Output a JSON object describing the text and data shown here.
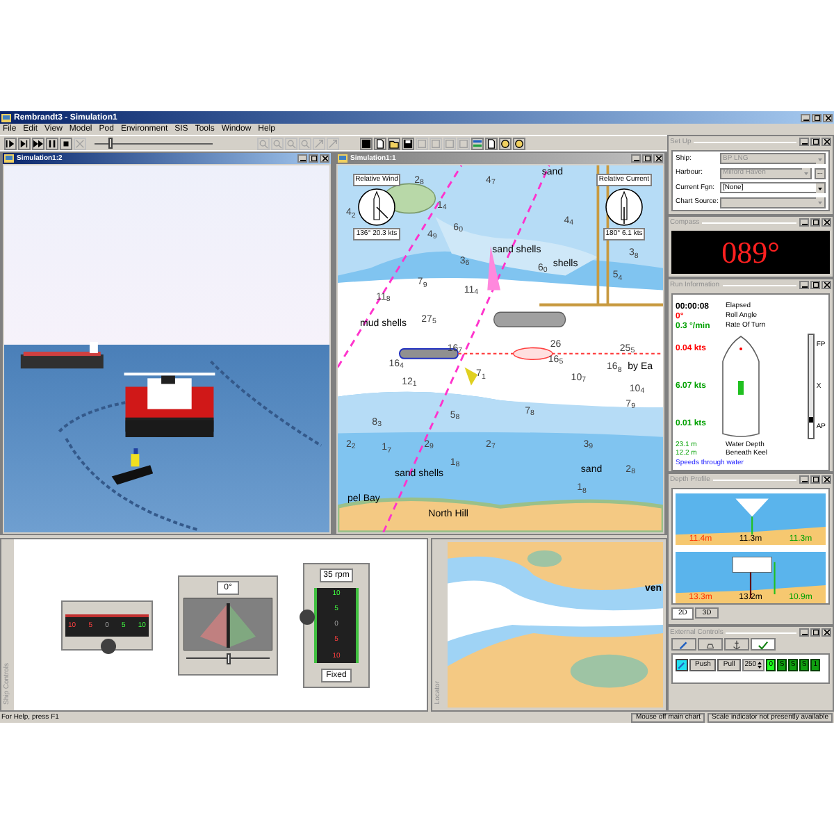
{
  "window": {
    "title": "Rembrandt3 - Simulation1"
  },
  "menu": [
    "File",
    "Edit",
    "View",
    "Model",
    "Pod",
    "Environment",
    "SIS",
    "Tools",
    "Window",
    "Help"
  ],
  "toolbar": {
    "groups": [
      [
        {
          "disabled": false
        },
        {
          "disabled": false
        },
        {
          "disabled": false
        },
        {
          "disabled": false
        },
        {
          "disabled": false
        },
        {
          "disabled": true
        }
      ],
      [
        {
          "disabled": true
        },
        {
          "disabled": true
        },
        {
          "disabled": true
        },
        {
          "disabled": true
        },
        {
          "disabled": true
        },
        {
          "disabled": true
        }
      ],
      [
        {
          "disabled": false
        },
        {
          "disabled": false
        },
        {
          "disabled": false
        },
        {
          "disabled": false
        },
        {
          "disabled": true
        },
        {
          "disabled": true
        },
        {
          "disabled": true
        },
        {
          "disabled": true
        },
        {
          "disabled": false
        },
        {
          "disabled": false
        },
        {
          "disabled": false
        },
        {
          "disabled": false
        }
      ]
    ],
    "slider": {
      "level": 0.12
    }
  },
  "views": [
    {
      "kind": "scene",
      "title": "Simulation1:2",
      "active": true
    },
    {
      "kind": "chart",
      "title": "Simulation1:1",
      "active": false,
      "gauges": [
        {
          "label": "Relative Wind",
          "reading": "136° 20.3 kts"
        },
        {
          "label": "Relative Current",
          "reading": "180° 6.1 kts"
        }
      ],
      "chart_labels": [
        {
          "kind": "name",
          "text": "sand"
        },
        {
          "kind": "sounding",
          "text": "2$_{8}$"
        },
        {
          "kind": "sounding",
          "text": "4$_{7}$"
        },
        {
          "kind": "sounding",
          "text": "4$_{2}$"
        },
        {
          "kind": "sounding",
          "text": "1$_{4}$"
        },
        {
          "kind": "sounding",
          "text": "4$_{4}$"
        },
        {
          "kind": "sounding",
          "text": "6$_{0}$"
        },
        {
          "kind": "sounding",
          "text": "4$_{9}$"
        },
        {
          "kind": "name",
          "text": "sand shells"
        },
        {
          "kind": "sounding",
          "text": "3$_{6}$"
        },
        {
          "kind": "sounding",
          "text": "3$_{8}$"
        },
        {
          "kind": "name",
          "text": "shells"
        },
        {
          "kind": "sounding",
          "text": "6$_{0}$"
        },
        {
          "kind": "sounding",
          "text": "5$_{4}$"
        },
        {
          "kind": "sounding",
          "text": "7$_{9}$"
        },
        {
          "kind": "sounding",
          "text": "11$_{4}$"
        },
        {
          "kind": "sounding",
          "text": "11$_{8}$"
        },
        {
          "kind": "name",
          "text": "mud shells"
        },
        {
          "kind": "sounding",
          "text": "27$_{5}$"
        },
        {
          "kind": "sounding",
          "text": "26"
        },
        {
          "kind": "sounding",
          "text": "25$_{5}$"
        },
        {
          "kind": "sounding",
          "text": "16$_{7}$"
        },
        {
          "kind": "sounding",
          "text": "16$_{4}$"
        },
        {
          "kind": "sounding",
          "text": "16$_{5}$"
        },
        {
          "kind": "sounding",
          "text": "16$_{8}$"
        },
        {
          "kind": "name",
          "text": "by Ea"
        },
        {
          "kind": "sounding",
          "text": "12$_{1}$"
        },
        {
          "kind": "sounding",
          "text": "7$_{1}$"
        },
        {
          "kind": "sounding",
          "text": "10$_{7}$"
        },
        {
          "kind": "sounding",
          "text": "10$_{4}$"
        },
        {
          "kind": "sounding",
          "text": "7$_{9}$"
        },
        {
          "kind": "sounding",
          "text": "5$_{8}$"
        },
        {
          "kind": "sounding",
          "text": "7$_{8}$"
        },
        {
          "kind": "sounding",
          "text": "8$_{3}$"
        },
        {
          "kind": "sounding",
          "text": "2$_{2}$"
        },
        {
          "kind": "sounding",
          "text": "1$_{7}$"
        },
        {
          "kind": "sounding",
          "text": "2$_{9}$"
        },
        {
          "kind": "sounding",
          "text": "2$_{7}$"
        },
        {
          "kind": "sounding",
          "text": "3$_{9}$"
        },
        {
          "kind": "sounding",
          "text": "1$_{8}$"
        },
        {
          "kind": "name",
          "text": "sand shells"
        },
        {
          "kind": "name",
          "text": "sand"
        },
        {
          "kind": "sounding",
          "text": "2$_{8}$"
        },
        {
          "kind": "sounding",
          "text": "1$_{8}$"
        },
        {
          "kind": "name",
          "text": "pel Bay"
        },
        {
          "kind": "name",
          "text": "North Hill"
        }
      ]
    }
  ],
  "ship_controls": {
    "side_label": "Ship Controls",
    "thruster": {
      "scale": [
        "10",
        "5",
        "0",
        "5",
        "10"
      ]
    },
    "rudder": {
      "reading": "0°",
      "level": 0.5
    },
    "engine": {
      "reading": "35 rpm",
      "mode": "Fixed",
      "scale": [
        "10",
        "5",
        "0",
        "5",
        "10"
      ]
    }
  },
  "locator": {
    "side_label": "Locator",
    "label": "ven"
  },
  "setup": {
    "title": "Set Up",
    "fields": [
      {
        "label": "Ship:",
        "value": "BP LNG",
        "disabled": true
      },
      {
        "label": "Harbour:",
        "value": "Milford Haven",
        "disabled": true,
        "button": "..."
      },
      {
        "label": "Current Fgn:",
        "value": "[None]",
        "disabled": false
      },
      {
        "label": "Chart Source:",
        "disabled": true
      }
    ]
  },
  "compass": {
    "title": "Compass",
    "heading": "089°"
  },
  "run_info": {
    "title": "Run Information",
    "rows": [
      {
        "value": "00:00:08",
        "label": "Elapsed",
        "color": "#000000"
      },
      {
        "value": "0°",
        "label": "Roll Angle",
        "color": "#ff0000"
      },
      {
        "value": "0.3 °/min",
        "label": "Rate Of Turn",
        "color": "#00a000"
      }
    ],
    "speeds": [
      {
        "value": "0.04 kts",
        "color": "#ff0000"
      },
      {
        "value": "6.07 kts",
        "color": "#00a000"
      },
      {
        "value": "0.01 kts",
        "color": "#00a000"
      }
    ],
    "depths": [
      {
        "value": "23.1 m",
        "label": "Water Depth"
      },
      {
        "value": "12.2 m",
        "label": "Beneath Keel"
      }
    ],
    "note": "Speeds through water",
    "scale": {
      "marks": [
        "FP",
        "X",
        "AP"
      ],
      "level": 0.85
    }
  },
  "depth_profile": {
    "title": "Depth Profile",
    "profiles": [
      {
        "kind": "triangle",
        "readings": [
          {
            "text": "11.4m",
            "color": "#ff3300"
          },
          {
            "text": "11.3m",
            "color": "#000000"
          },
          {
            "text": "11.3m",
            "color": "#00a000"
          }
        ]
      },
      {
        "kind": "block",
        "readings": [
          {
            "text": "13.3m",
            "color": "#ff3300"
          },
          {
            "text": "13.2m",
            "color": "#000000"
          },
          {
            "text": "10.9m",
            "color": "#00a000"
          }
        ]
      }
    ],
    "tabs": [
      {
        "label": "2D",
        "selected": true
      },
      {
        "label": "3D",
        "selected": false
      }
    ]
  },
  "external_controls": {
    "title": "External Controls",
    "tabs": [
      {
        "selected": false
      },
      {
        "selected": false
      },
      {
        "selected": false
      },
      {
        "selected": true
      }
    ],
    "buttons": [
      "Push",
      "Pull"
    ],
    "spinner": "250",
    "indicators": [
      {
        "text": "0",
        "on": true
      },
      {
        "text": "S",
        "on": false
      },
      {
        "text": "S",
        "on": false
      },
      {
        "text": "S",
        "on": false
      },
      {
        "text": "1",
        "on": false
      }
    ]
  },
  "status_bar": [
    "For Help, press F1",
    "Mouse off main chart",
    "Scale indicator not presently available"
  ]
}
